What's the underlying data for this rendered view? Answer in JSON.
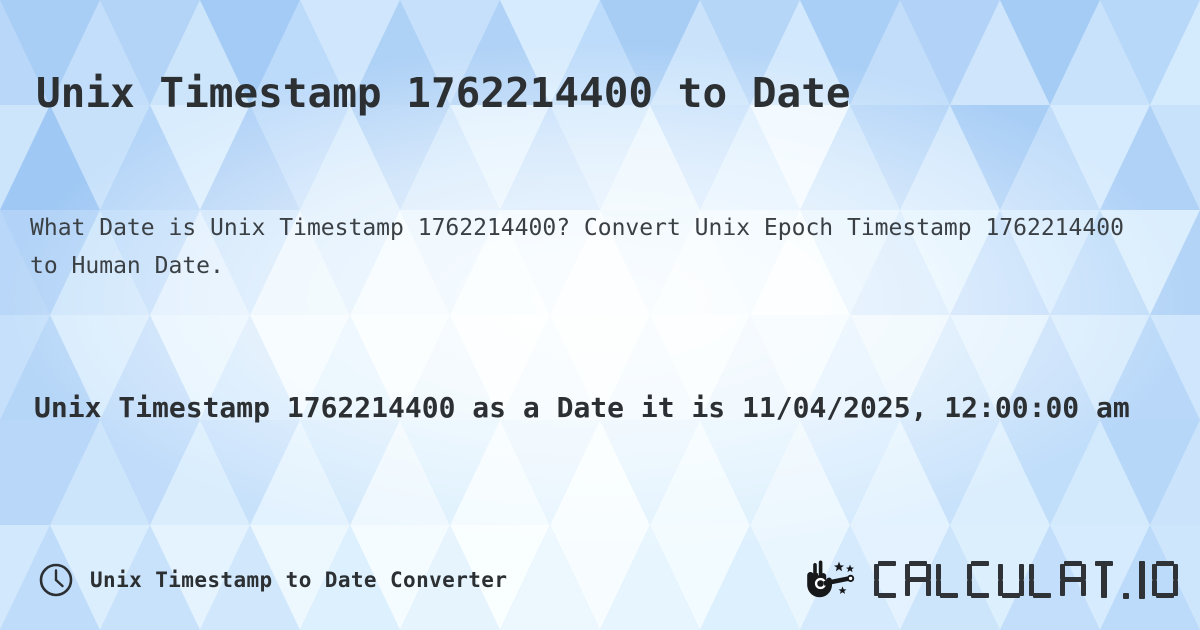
{
  "page": {
    "title": "Unix Timestamp 1762214400 to Date",
    "description": "What Date is Unix Timestamp 1762214400? Convert Unix Epoch Timestamp 1762214400 to Human Date.",
    "result": "Unix Timestamp 1762214400 as a Date it is 11/04/2025, 12:00:00 am"
  },
  "values": {
    "timestamp": "1762214400",
    "human_date": "11/04/2025, 12:00:00 am",
    "date_part": "11/04/2025",
    "time_part": "12:00:00 am"
  },
  "footer": {
    "clock_icon": "clock-icon",
    "label": "Unix Timestamp to Date Converter",
    "brand": {
      "wand_icon": "magic-wand-hand-icon",
      "text": "CALCULAT.IO",
      "chars": [
        "C",
        "A",
        "L",
        "C",
        "U",
        "L",
        "A",
        "T",
        ".",
        "I",
        "O"
      ]
    }
  },
  "colors": {
    "text_dark": "#2c3033",
    "text_body": "#3b4045",
    "background_blue": "#a8cdf5",
    "background_light": "#eaf4fe",
    "brand_dark": "#2f3337"
  }
}
